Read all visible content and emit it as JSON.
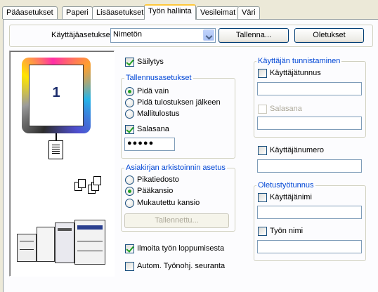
{
  "tabs": [
    {
      "label": "Pääasetukset"
    },
    {
      "label": "Paperi"
    },
    {
      "label": "Lisäasetukset"
    },
    {
      "label": "Työn hallinta"
    },
    {
      "label": "Vesileimat"
    },
    {
      "label": "Väri"
    }
  ],
  "top": {
    "user_settings_label": "Käyttäjäasetukset:",
    "user_settings_value": "Nimetön",
    "save_button": "Tallenna...",
    "defaults_button": "Oletukset"
  },
  "preview": {
    "page_number": "1"
  },
  "retention": {
    "label": "Säilytys",
    "checked": true
  },
  "storage_settings": {
    "legend": "Tallennusasetukset",
    "options": [
      {
        "label": "Pidä vain",
        "selected": true
      },
      {
        "label": "Pidä tulostuksen jälkeen",
        "selected": false
      },
      {
        "label": "Mallitulostus",
        "selected": false
      }
    ],
    "password_label": "Salasana",
    "password_checked": true,
    "password_value": "●●●●●"
  },
  "archive": {
    "legend": "Asiakirjan arkistoinnin asetus",
    "options": [
      {
        "label": "Pikatiedosto",
        "selected": false
      },
      {
        "label": "Pääkansio",
        "selected": true
      },
      {
        "label": "Mukautettu kansio",
        "selected": false
      }
    ],
    "save_button": "Tallennettu..."
  },
  "notify_end": {
    "label": "Ilmoita työn loppumisesta",
    "checked": true
  },
  "auto_tracking": {
    "label": "Autom. Työnohj. seuranta",
    "checked": false
  },
  "user_auth": {
    "legend": "Käyttäjän tunnistaminen",
    "user_id_label": "Käyttäjätunnus",
    "password_label": "Salasana"
  },
  "user_number": {
    "label": "Käyttäjänumero"
  },
  "default_job_id": {
    "legend": "Oletustyötunnus",
    "user_name_label": "Käyttäjänimi",
    "job_name_label": "Työn nimi"
  }
}
